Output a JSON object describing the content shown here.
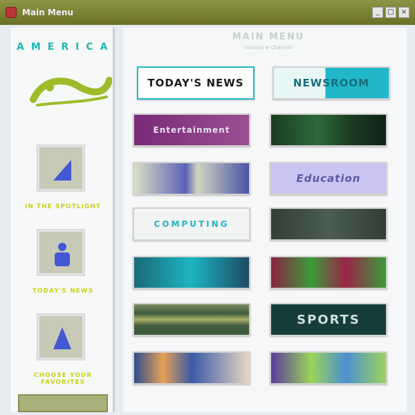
{
  "window": {
    "title": "Main Menu",
    "buttons": [
      "_",
      "□",
      "×"
    ]
  },
  "sidebar": {
    "logo": {
      "word": "AMERICA",
      "accent_color": "#1fb7b5",
      "swoosh_color": "#9fbb2a"
    },
    "cards": [
      {
        "label": "IN THE SPOTLIGHT",
        "icon": "blue-triangle-icon"
      },
      {
        "label": "TODAY'S NEWS",
        "icon": "blue-figure-icon"
      },
      {
        "label": "CHOOSE YOUR FAVORITES",
        "icon": "blue-arrow-icon"
      }
    ]
  },
  "main": {
    "heading": "MAIN MENU",
    "subheading": "choose a channel",
    "tiles": [
      {
        "label": "TODAY'S NEWS",
        "style": "news",
        "colors": [
          "#ffffff",
          "#1c1c1c"
        ]
      },
      {
        "label": "NEWSROOM",
        "style": "newsroom",
        "colors": [
          "#dff4f4",
          "#1fb7c9"
        ]
      },
      {
        "label": "Entertainment",
        "style": "purple",
        "colors": [
          "#7a2a78",
          "#e8e0ee"
        ]
      },
      {
        "label": "",
        "style": "green-dark",
        "colors": [
          "#1b3c22",
          "#ffffff"
        ]
      },
      {
        "label": "",
        "style": "blue-photo",
        "colors": [
          "#5b62b6",
          "#d9dfc7"
        ]
      },
      {
        "label": "Education",
        "style": "lavender",
        "colors": [
          "#c9c4f2",
          "#5a5aa5"
        ]
      },
      {
        "label": "COMPUTING",
        "style": "computing",
        "colors": [
          "#f2f4f4",
          "#29b1c8"
        ]
      },
      {
        "label": "",
        "style": "dark-green-text",
        "colors": [
          "#2f3f35",
          "#d8dfd7"
        ]
      },
      {
        "label": "",
        "style": "teal",
        "colors": [
          "#1b6a77",
          "#1bb5c2"
        ]
      },
      {
        "label": "",
        "style": "red-green",
        "colors": [
          "#8b2242",
          "#3c9b3a"
        ]
      },
      {
        "label": "",
        "style": "green-bar",
        "colors": [
          "#3f5a3d",
          "#a7b16a"
        ]
      },
      {
        "label": "SPORTS",
        "style": "sports",
        "colors": [
          "#163d3c",
          "#cfe0df"
        ]
      },
      {
        "label": "",
        "style": "blue-orange",
        "colors": [
          "#2f4d8f",
          "#e6a054"
        ]
      },
      {
        "label": "",
        "style": "purple-green",
        "colors": [
          "#5a3d9e",
          "#9cd45a"
        ]
      }
    ]
  }
}
